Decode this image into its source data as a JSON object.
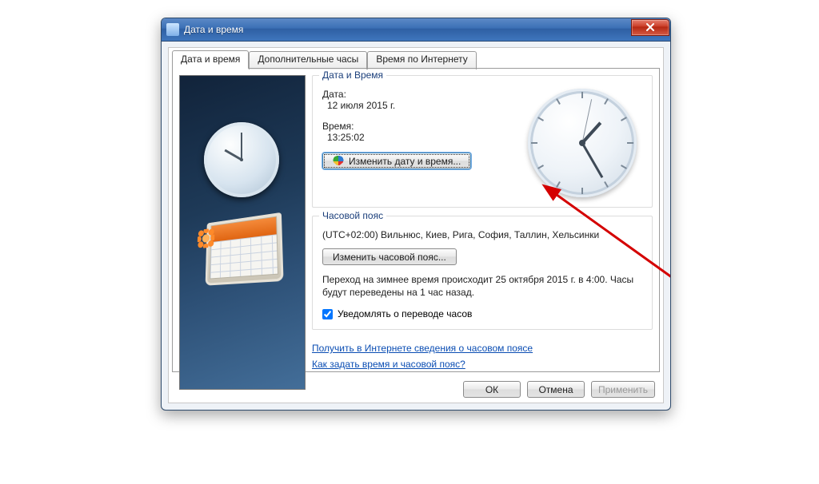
{
  "window": {
    "title": "Дата и время"
  },
  "tabs": {
    "t0": "Дата и время",
    "t1": "Дополнительные часы",
    "t2": "Время по Интернету"
  },
  "group_datetime": {
    "legend": "Дата и Время",
    "date_label": "Дата:",
    "date_value": "12 июля 2015 г.",
    "time_label": "Время:",
    "time_value": "13:25:02",
    "change_btn": "Изменить дату и время..."
  },
  "group_tz": {
    "legend": "Часовой пояс",
    "tz_value": "(UTC+02:00) Вильнюс, Киев, Рига, София, Таллин, Хельсинки",
    "change_btn": "Изменить часовой пояс...",
    "dst_info": "Переход на зимнее время происходит 25 октября 2015 г. в 4:00. Часы будут переведены на 1 час назад.",
    "notify_label": "Уведомлять о переводе часов"
  },
  "links": {
    "tz_online": "Получить в Интернете сведения о часовом поясе",
    "howto": "Как задать время и часовой пояс?"
  },
  "buttons": {
    "ok": "ОК",
    "cancel": "Отмена",
    "apply": "Применить"
  }
}
